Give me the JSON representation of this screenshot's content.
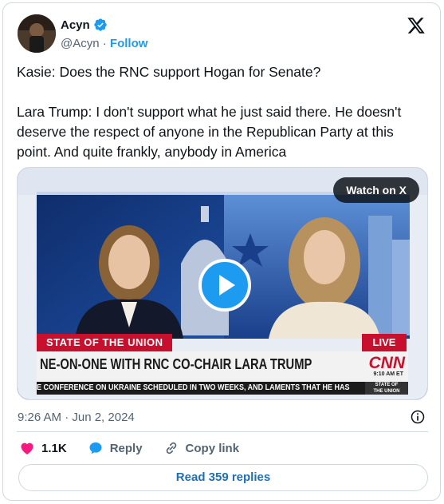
{
  "author": {
    "name": "Acyn",
    "handle": "@Acyn",
    "separator": "·",
    "follow_label": "Follow"
  },
  "tweet": {
    "text": "Kasie: Does the RNC support Hogan for Senate?\n\nLara Trump: I don't support what he just said there. He doesn't deserve the respect of anyone in the Republican Party at this point. And quite frankly, anybody in America",
    "timestamp": "9:26 AM · Jun 2, 2024"
  },
  "media": {
    "watch_label": "Watch on X",
    "broadcast": {
      "show_label": "STATE OF THE UNION",
      "live_label": "LIVE",
      "headline": "NE-ON-ONE WITH RNC CO-CHAIR LARA TRUMP",
      "network": "CNN",
      "time": "9:10 AM ET",
      "ticker": "E CONFERENCE ON UKRAINE SCHEDULED IN TWO WEEKS, AND LAMENTS THAT HE HAS",
      "corner_label_line1": "STATE OF",
      "corner_label_line2": "THE UNION"
    }
  },
  "actions": {
    "likes": "1.1K",
    "reply_label": "Reply",
    "copy_label": "Copy link"
  },
  "replies_button": "Read 359 replies",
  "colors": {
    "accent": "#1d9bf0",
    "like": "#f91880",
    "cnn_red": "#c8102e",
    "text": "#0f1419",
    "muted": "#536471"
  }
}
